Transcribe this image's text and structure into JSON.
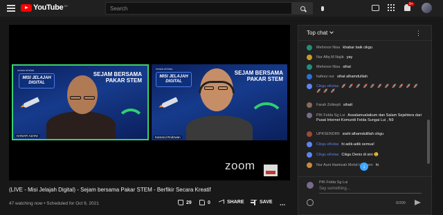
{
  "header": {
    "logo_text": "YouTube",
    "logo_region": "MY",
    "search_placeholder": "Search",
    "notification_count": "9+"
  },
  "video": {
    "overlay": {
      "left_panel": {
        "mini_logos": "mesta  eKelas",
        "badge": "MISI JELAJAH DIGITAL",
        "title": "SEJAM BERSAMA PAKAR STEM",
        "name_tag": "HANAFI AZANI"
      },
      "right_panel": {
        "mini_logos": "mesta  eKelas",
        "badge": "MISI JELAJAH DIGITAL",
        "title": "SEJAM BERSAMA PAKAR STEM",
        "name_tag": "Kamarul Rodzwan"
      },
      "zoom_logo": "zoom"
    },
    "title": "(LIVE - Misi Jelajah Digital) - Sejam bersama Pakar STEM - Berfikir Secara Kreatif",
    "meta": "47 watching now • Scheduled for Oct 9, 2021",
    "actions": {
      "likes": "29",
      "dislikes": "0",
      "share": "SHARE",
      "save": "SAVE",
      "more": "..."
    }
  },
  "chat": {
    "header": "Top chat",
    "messages": [
      {
        "author": "Mehroon Nisa",
        "text": "khabar baik cikgu",
        "avatar_color": "#1f8f7a",
        "moderator": false
      },
      {
        "author": "Nur Afiq M Najib",
        "text": "yay",
        "avatar_color": "#c79a2a",
        "moderator": false
      },
      {
        "author": "Mehroon Nisa",
        "text": "sihat",
        "avatar_color": "#1f8f7a",
        "moderator": false
      },
      {
        "author": "hafeez nur",
        "text": "sihat alhamdulilah",
        "avatar_color": "#2f6fd0",
        "moderator": false
      },
      {
        "author": "Cikgu eKelas",
        "text": "🚀 🚀 🚀 🚀 🚀 🚀 🚀 🚀 🚀 🚀 🚀 🚀 🚀 🚀",
        "avatar_color": "#5e84f1",
        "moderator": true
      },
      {
        "author": "Farah Zolkepli",
        "text": "sihatt",
        "avatar_color": "#8a6a5a",
        "moderator": false
      },
      {
        "author": "PIK Felda Sg Lui",
        "text": "Assalamualaikum dan Salam Sejahtera dari Pusat Internet Komuniti Felda Sungai Lui , N9",
        "avatar_color": "#7a6a8a",
        "moderator": false
      },
      {
        "author": "UPKSENDIRI",
        "text": "siaht alhamdulillah cikgu",
        "avatar_color": "#9a4a3a",
        "moderator": false
      },
      {
        "author": "Cikgu eKelas",
        "text": "hi adik-adik semua!",
        "avatar_color": "#5e84f1",
        "moderator": true
      },
      {
        "author": "Cikgu eKelas",
        "text": "Cikgu Denis di sini 😉",
        "avatar_color": "#5e84f1",
        "moderator": true
      },
      {
        "author": "Nur Auni Hamizah Mohd Hakeem",
        "text": "hi",
        "avatar_color": "#c78a3a",
        "moderator": false
      }
    ],
    "composer": {
      "name": "PIK Felda Sg Lui",
      "placeholder": "Say something...",
      "counter": "0/200"
    }
  }
}
